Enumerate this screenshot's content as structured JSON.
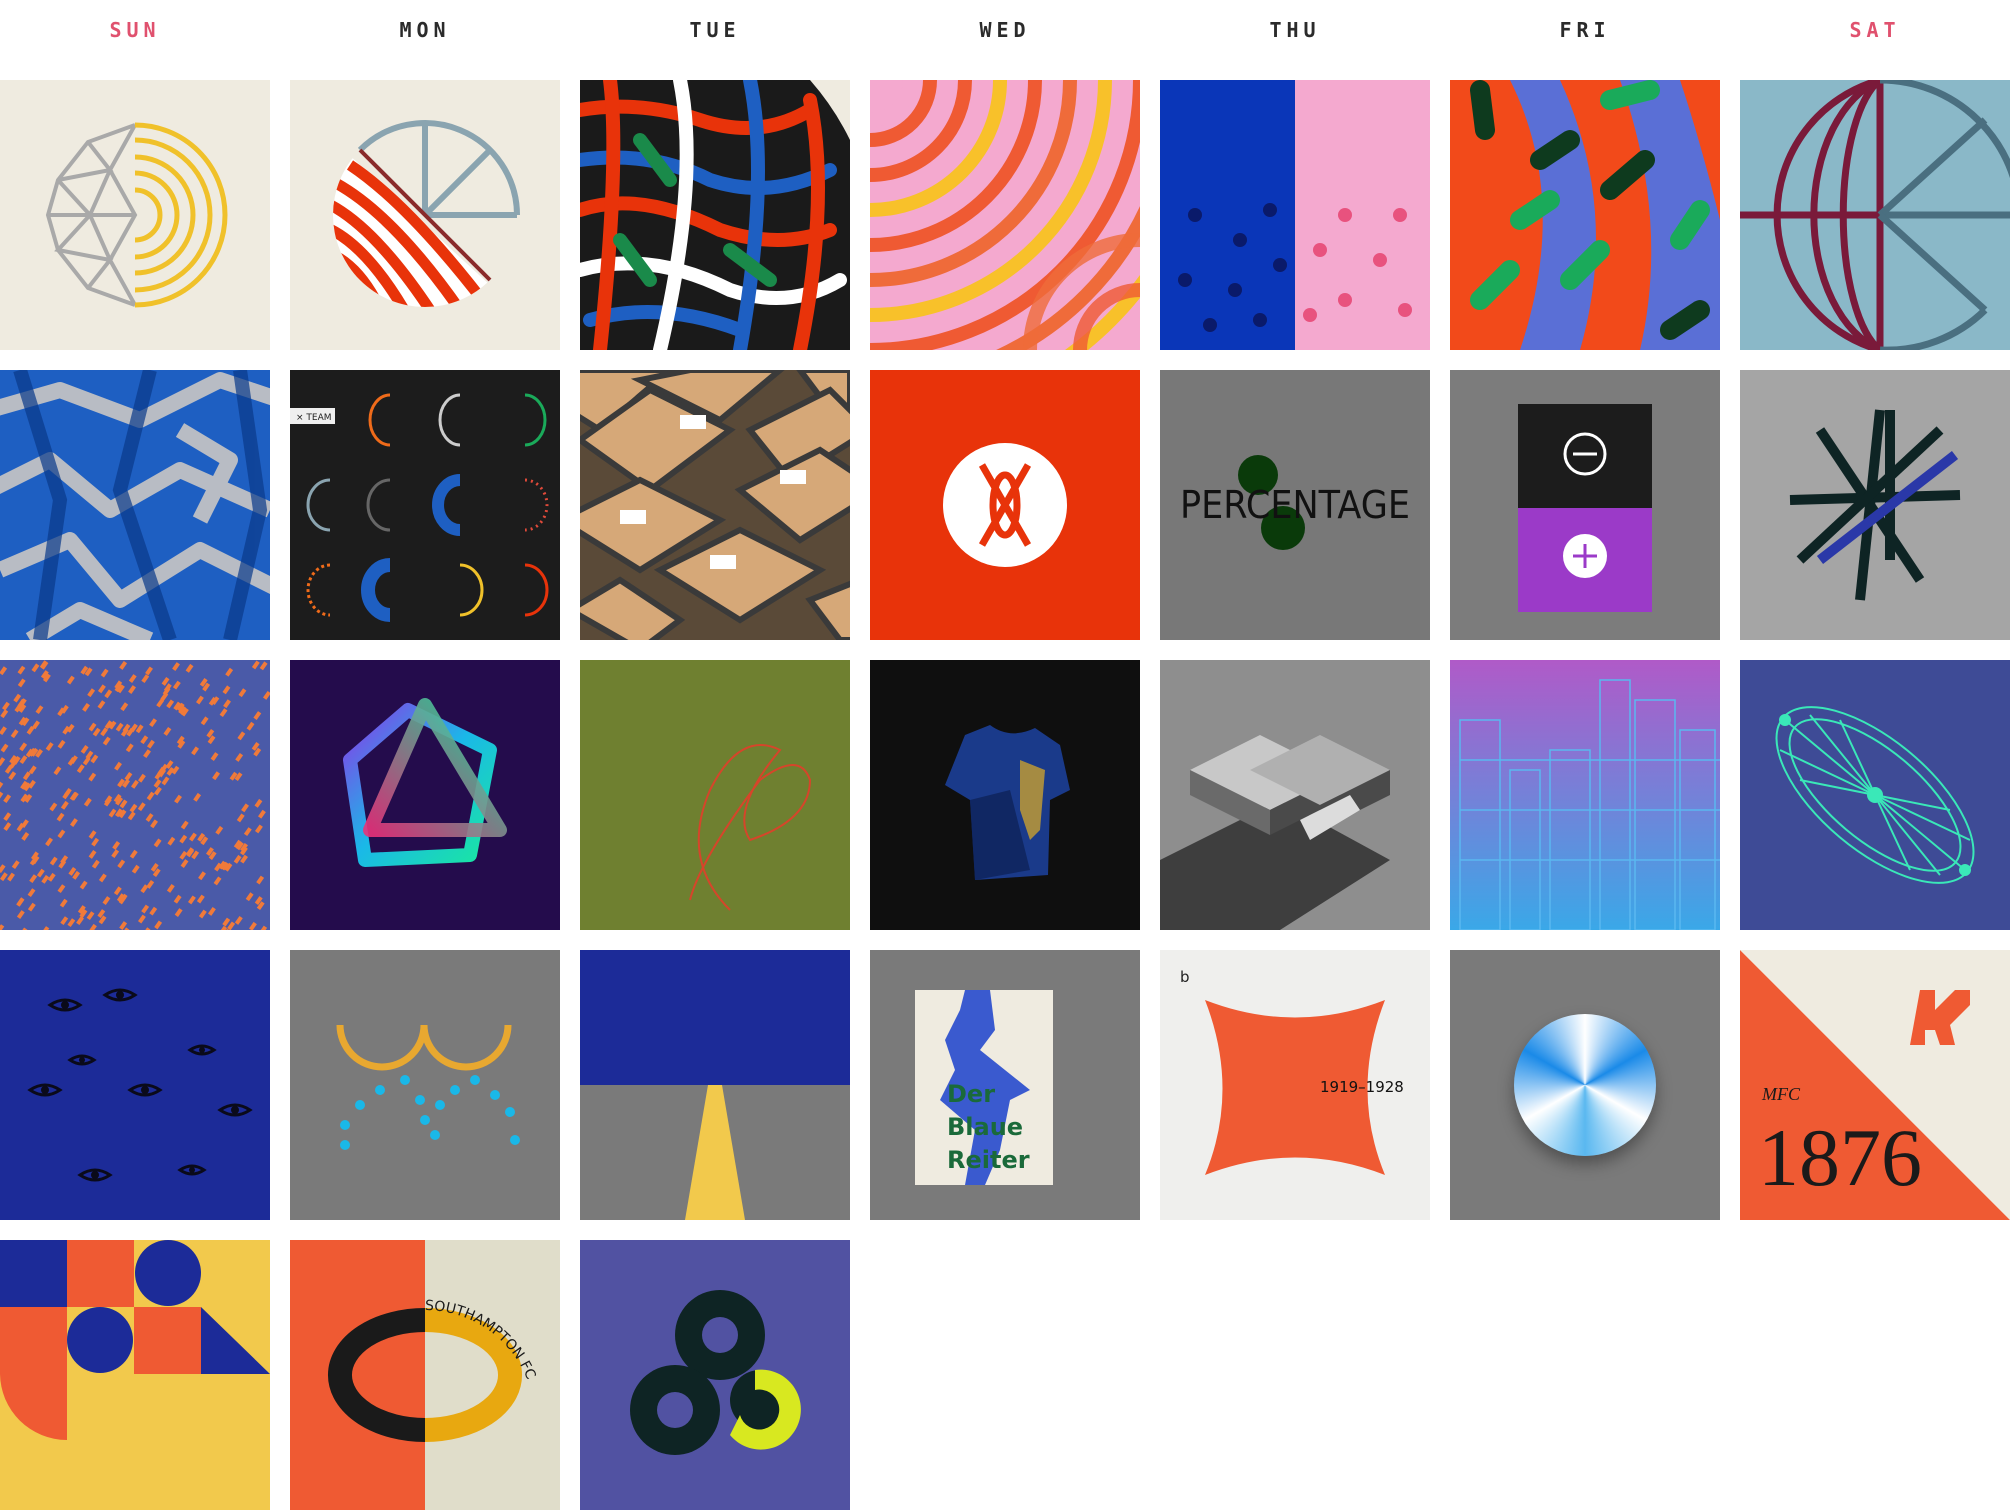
{
  "days": [
    "SUN",
    "MON",
    "TUE",
    "WED",
    "THU",
    "FRI",
    "SAT"
  ],
  "colors": {
    "weekend": "#e0516e",
    "weekday": "#2b2b2b",
    "background": "#ffffff"
  },
  "tiles": {
    "r1c1": {
      "name": "geodesic-dome-sphere",
      "bg": "#efebe0"
    },
    "r1c2": {
      "name": "wheel-and-waves-circle",
      "bg": "#efebe0"
    },
    "r1c3": {
      "name": "rgb-overlap-quarter-arcs",
      "bg": "#efebe0"
    },
    "r1c4": {
      "name": "concentric-colored-arcs",
      "bg": "#f4a9cf"
    },
    "r1c5": {
      "name": "split-dots-blue-pink",
      "bg": "#f4a9cf"
    },
    "r1c6": {
      "name": "pills-and-diagonal-stripes",
      "bg": "#5a6fd6"
    },
    "r1c7": {
      "name": "globe-and-wheel-split",
      "bg": "#8ab8c8"
    },
    "r2c1": {
      "name": "blue-grey-ribbons",
      "bg": "#1e5fc2"
    },
    "r2c2": {
      "name": "icon-grid-dark",
      "bg": "#1c1c1c",
      "team_label": "× TEAM"
    },
    "r2c3": {
      "name": "isometric-boxes",
      "bg": "#5a4a38"
    },
    "r2c4": {
      "name": "x-logo-circle",
      "bg": "#e8330a"
    },
    "r2c5": {
      "name": "percentage-word",
      "bg": "#787878",
      "word": "PERCENTAGE"
    },
    "r2c6": {
      "name": "minus-plus-stepper",
      "bg": "#7c7c7c",
      "minus": "−",
      "plus": "+"
    },
    "r2c7": {
      "name": "asterisk-lines",
      "bg": "#a5a5a5"
    },
    "r3c1": {
      "name": "orange-dashes-pattern",
      "bg": "#4a5aa8"
    },
    "r3c2": {
      "name": "gradient-pentagram",
      "bg": "#240c4c"
    },
    "r3c3": {
      "name": "thin-loop-line",
      "bg": "#6f8030"
    },
    "r3c4": {
      "name": "3d-jersey",
      "bg": "#0f0f0f"
    },
    "r3c5": {
      "name": "isometric-buildings",
      "bg": "#8e8e8e"
    },
    "r3c6": {
      "name": "wireframe-skyline",
      "bg": "#b05ac8"
    },
    "r3c7": {
      "name": "london-eye-wireframe",
      "bg": "#3e4b96"
    },
    "r4c1": {
      "name": "eyes-pattern",
      "bg": "#1c2b98"
    },
    "r4c2": {
      "name": "double-arcs-and-dots",
      "bg": "#7a7a7a"
    },
    "r4c3": {
      "name": "road-horizon",
      "bg": "#7a7a7a"
    },
    "r4c4": {
      "name": "der-blaue-reiter-poster",
      "bg": "#7a7a7a",
      "poster": [
        "Der",
        "Blaue",
        "Reiter"
      ]
    },
    "r4c5": {
      "name": "bauhaus-star",
      "bg": "#efefed",
      "letter": "b",
      "years": "1919–1928"
    },
    "r4c6": {
      "name": "conic-disc",
      "bg": "#7a7a7a"
    },
    "r4c7": {
      "name": "mfc-1876-crest",
      "bg": "#efebe0",
      "club": "MFC",
      "year": "1876"
    },
    "r5c1": {
      "name": "bauhaus-geometric-blocks",
      "bg": "#f2c94c"
    },
    "r5c2": {
      "name": "southampton-fc-badge",
      "bg": "#e0ddca",
      "club": "SOUTHAMPTON FC"
    },
    "r5c3": {
      "name": "trefoil-knot",
      "bg": "#5152a2"
    }
  }
}
